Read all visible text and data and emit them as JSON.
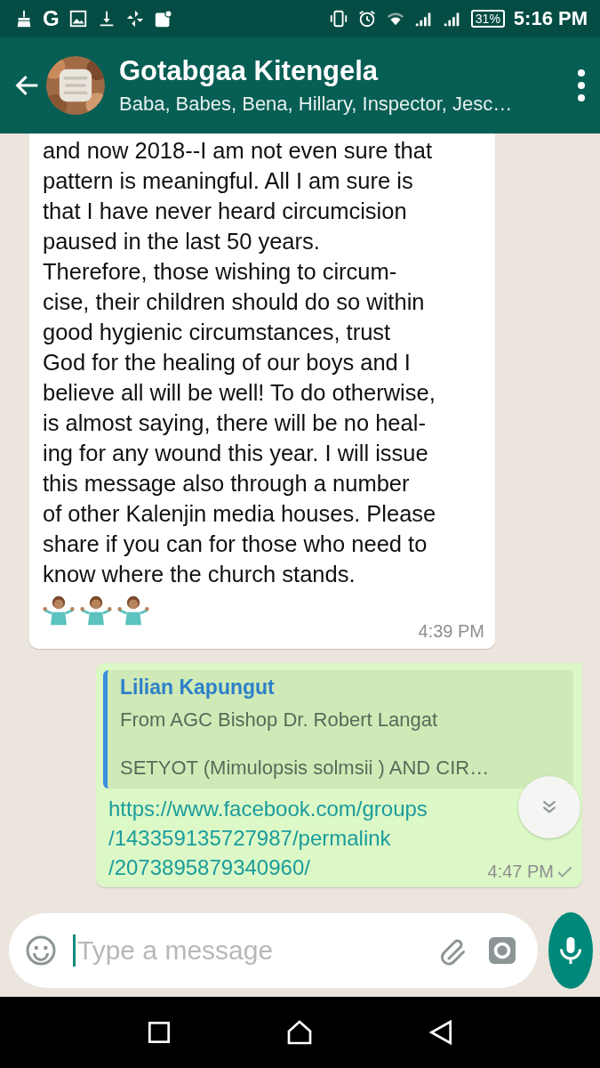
{
  "status_bar": {
    "notification_letter": "G",
    "battery": "31%",
    "time": "5:16 PM"
  },
  "header": {
    "title": "Gotabgaa Kitengela",
    "subtitle": "Baba, Babes, Bena, Hillary, Inspector, Jesc…"
  },
  "messages": [
    {
      "kind": "incoming",
      "text": "and now 2018--I am not even sure that\npattern is meaningful. All I am sure is\nthat I have never heard circumcision\npaused in the last 50 years.\nTherefore, those wishing to circum-\ncise, their children should do so within\ngood hygienic circumstances, trust\nGod for the healing of our boys and I\nbelieve all will be well! To do otherwise,\nis almost saying, there will be no heal-\ning for any wound this year. I will issue\nthis message also through a number\nof other Kalenjin media houses. Please\nshare if you can for those who need to\nknow where the church stands.",
      "time": "4:39 PM"
    },
    {
      "kind": "outgoing",
      "quote": {
        "author": "Lilian Kapungut",
        "lines": [
          "From AGC Bishop Dr. Robert Langat",
          "SETYOT (Mimulopsis solmsii ) AND CIR…"
        ]
      },
      "link": "https://www.facebook.com/groups\n/143359135727987/permalink\n/2073895879340960/",
      "time": "4:47 PM",
      "delivered": false
    }
  ],
  "composer": {
    "placeholder": "Type a message"
  }
}
